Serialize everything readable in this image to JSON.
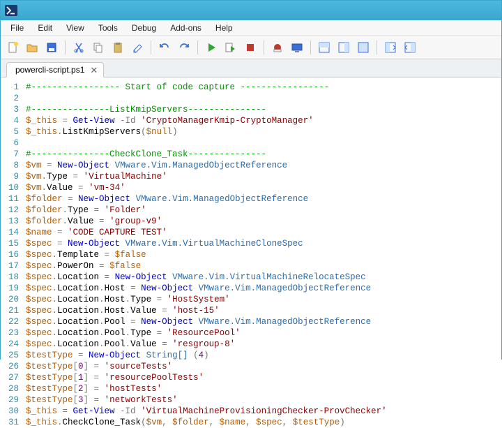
{
  "window": {
    "app_icon": "powershell-icon"
  },
  "menubar": {
    "items": [
      "File",
      "Edit",
      "View",
      "Tools",
      "Debug",
      "Add-ons",
      "Help"
    ]
  },
  "toolbar": {
    "buttons": [
      {
        "name": "new-file-icon"
      },
      {
        "name": "open-file-icon"
      },
      {
        "name": "save-icon"
      },
      {
        "sep": true
      },
      {
        "name": "cut-icon"
      },
      {
        "name": "copy-icon"
      },
      {
        "name": "paste-icon"
      },
      {
        "name": "clear-icon"
      },
      {
        "sep": true
      },
      {
        "name": "undo-icon"
      },
      {
        "name": "redo-icon"
      },
      {
        "sep": true
      },
      {
        "name": "run-icon"
      },
      {
        "name": "run-selection-icon"
      },
      {
        "name": "stop-icon"
      },
      {
        "sep": true
      },
      {
        "name": "breakpoint-icon"
      },
      {
        "name": "remote-icon"
      },
      {
        "sep": true
      },
      {
        "name": "pane-script-icon"
      },
      {
        "name": "pane-right-icon"
      },
      {
        "name": "pane-max-icon"
      },
      {
        "sep": true
      },
      {
        "name": "show-commands-icon"
      },
      {
        "name": "show-addon-icon"
      }
    ]
  },
  "tab": {
    "label": "powercli-script.ps1",
    "close": "✕"
  },
  "code": {
    "lines": [
      [
        {
          "t": "comment",
          "v": "#----------------- Start of code capture -----------------"
        }
      ],
      [],
      [
        {
          "t": "comment",
          "v": "#---------------ListKmipServers---------------"
        }
      ],
      [
        {
          "t": "var",
          "v": "$_this"
        },
        {
          "t": "punc",
          "v": " = "
        },
        {
          "t": "cmdlet",
          "v": "Get-View"
        },
        {
          "t": "punc",
          "v": " -Id "
        },
        {
          "t": "str",
          "v": "'CryptoManagerKmip-CryptoManager'"
        }
      ],
      [
        {
          "t": "var",
          "v": "$_this"
        },
        {
          "t": "punc",
          "v": "."
        },
        {
          "t": "prop",
          "v": "ListKmipServers"
        },
        {
          "t": "punc",
          "v": "("
        },
        {
          "t": "var",
          "v": "$null"
        },
        {
          "t": "punc",
          "v": ")"
        }
      ],
      [],
      [
        {
          "t": "comment",
          "v": "#---------------CheckClone_Task---------------"
        }
      ],
      [
        {
          "t": "var",
          "v": "$vm"
        },
        {
          "t": "punc",
          "v": " = "
        },
        {
          "t": "cmdlet",
          "v": "New-Object"
        },
        {
          "t": "punc",
          "v": " "
        },
        {
          "t": "type",
          "v": "VMware.Vim.ManagedObjectReference"
        }
      ],
      [
        {
          "t": "var",
          "v": "$vm"
        },
        {
          "t": "punc",
          "v": "."
        },
        {
          "t": "prop",
          "v": "Type"
        },
        {
          "t": "punc",
          "v": " = "
        },
        {
          "t": "str",
          "v": "'VirtualMachine'"
        }
      ],
      [
        {
          "t": "var",
          "v": "$vm"
        },
        {
          "t": "punc",
          "v": "."
        },
        {
          "t": "prop",
          "v": "Value"
        },
        {
          "t": "punc",
          "v": " = "
        },
        {
          "t": "str",
          "v": "'vm-34'"
        }
      ],
      [
        {
          "t": "var",
          "v": "$folder"
        },
        {
          "t": "punc",
          "v": " = "
        },
        {
          "t": "cmdlet",
          "v": "New-Object"
        },
        {
          "t": "punc",
          "v": " "
        },
        {
          "t": "type",
          "v": "VMware.Vim.ManagedObjectReference"
        }
      ],
      [
        {
          "t": "var",
          "v": "$folder"
        },
        {
          "t": "punc",
          "v": "."
        },
        {
          "t": "prop",
          "v": "Type"
        },
        {
          "t": "punc",
          "v": " = "
        },
        {
          "t": "str",
          "v": "'Folder'"
        }
      ],
      [
        {
          "t": "var",
          "v": "$folder"
        },
        {
          "t": "punc",
          "v": "."
        },
        {
          "t": "prop",
          "v": "Value"
        },
        {
          "t": "punc",
          "v": " = "
        },
        {
          "t": "str",
          "v": "'group-v9'"
        }
      ],
      [
        {
          "t": "var",
          "v": "$name"
        },
        {
          "t": "punc",
          "v": " = "
        },
        {
          "t": "str",
          "v": "'CODE CAPTURE TEST'"
        }
      ],
      [
        {
          "t": "var",
          "v": "$spec"
        },
        {
          "t": "punc",
          "v": " = "
        },
        {
          "t": "cmdlet",
          "v": "New-Object"
        },
        {
          "t": "punc",
          "v": " "
        },
        {
          "t": "type",
          "v": "VMware.Vim.VirtualMachineCloneSpec"
        }
      ],
      [
        {
          "t": "var",
          "v": "$spec"
        },
        {
          "t": "punc",
          "v": "."
        },
        {
          "t": "prop",
          "v": "Template"
        },
        {
          "t": "punc",
          "v": " = "
        },
        {
          "t": "var",
          "v": "$false"
        }
      ],
      [
        {
          "t": "var",
          "v": "$spec"
        },
        {
          "t": "punc",
          "v": "."
        },
        {
          "t": "prop",
          "v": "PowerOn"
        },
        {
          "t": "punc",
          "v": " = "
        },
        {
          "t": "var",
          "v": "$false"
        }
      ],
      [
        {
          "t": "var",
          "v": "$spec"
        },
        {
          "t": "punc",
          "v": "."
        },
        {
          "t": "prop",
          "v": "Location"
        },
        {
          "t": "punc",
          "v": " = "
        },
        {
          "t": "cmdlet",
          "v": "New-Object"
        },
        {
          "t": "punc",
          "v": " "
        },
        {
          "t": "type",
          "v": "VMware.Vim.VirtualMachineRelocateSpec"
        }
      ],
      [
        {
          "t": "var",
          "v": "$spec"
        },
        {
          "t": "punc",
          "v": "."
        },
        {
          "t": "prop",
          "v": "Location"
        },
        {
          "t": "punc",
          "v": "."
        },
        {
          "t": "prop",
          "v": "Host"
        },
        {
          "t": "punc",
          "v": " = "
        },
        {
          "t": "cmdlet",
          "v": "New-Object"
        },
        {
          "t": "punc",
          "v": " "
        },
        {
          "t": "type",
          "v": "VMware.Vim.ManagedObjectReference"
        }
      ],
      [
        {
          "t": "var",
          "v": "$spec"
        },
        {
          "t": "punc",
          "v": "."
        },
        {
          "t": "prop",
          "v": "Location"
        },
        {
          "t": "punc",
          "v": "."
        },
        {
          "t": "prop",
          "v": "Host"
        },
        {
          "t": "punc",
          "v": "."
        },
        {
          "t": "prop",
          "v": "Type"
        },
        {
          "t": "punc",
          "v": " = "
        },
        {
          "t": "str",
          "v": "'HostSystem'"
        }
      ],
      [
        {
          "t": "var",
          "v": "$spec"
        },
        {
          "t": "punc",
          "v": "."
        },
        {
          "t": "prop",
          "v": "Location"
        },
        {
          "t": "punc",
          "v": "."
        },
        {
          "t": "prop",
          "v": "Host"
        },
        {
          "t": "punc",
          "v": "."
        },
        {
          "t": "prop",
          "v": "Value"
        },
        {
          "t": "punc",
          "v": " = "
        },
        {
          "t": "str",
          "v": "'host-15'"
        }
      ],
      [
        {
          "t": "var",
          "v": "$spec"
        },
        {
          "t": "punc",
          "v": "."
        },
        {
          "t": "prop",
          "v": "Location"
        },
        {
          "t": "punc",
          "v": "."
        },
        {
          "t": "prop",
          "v": "Pool"
        },
        {
          "t": "punc",
          "v": " = "
        },
        {
          "t": "cmdlet",
          "v": "New-Object"
        },
        {
          "t": "punc",
          "v": " "
        },
        {
          "t": "type",
          "v": "VMware.Vim.ManagedObjectReference"
        }
      ],
      [
        {
          "t": "var",
          "v": "$spec"
        },
        {
          "t": "punc",
          "v": "."
        },
        {
          "t": "prop",
          "v": "Location"
        },
        {
          "t": "punc",
          "v": "."
        },
        {
          "t": "prop",
          "v": "Pool"
        },
        {
          "t": "punc",
          "v": "."
        },
        {
          "t": "prop",
          "v": "Type"
        },
        {
          "t": "punc",
          "v": " = "
        },
        {
          "t": "str",
          "v": "'ResourcePool'"
        }
      ],
      [
        {
          "t": "var",
          "v": "$spec"
        },
        {
          "t": "punc",
          "v": "."
        },
        {
          "t": "prop",
          "v": "Location"
        },
        {
          "t": "punc",
          "v": "."
        },
        {
          "t": "prop",
          "v": "Pool"
        },
        {
          "t": "punc",
          "v": "."
        },
        {
          "t": "prop",
          "v": "Value"
        },
        {
          "t": "punc",
          "v": " = "
        },
        {
          "t": "str",
          "v": "'resgroup-8'"
        }
      ],
      [
        {
          "t": "var",
          "v": "$testType"
        },
        {
          "t": "punc",
          "v": " = "
        },
        {
          "t": "cmdlet",
          "v": "New-Object"
        },
        {
          "t": "punc",
          "v": " "
        },
        {
          "t": "type",
          "v": "String[]"
        },
        {
          "t": "punc",
          "v": " ("
        },
        {
          "t": "num",
          "v": "4"
        },
        {
          "t": "punc",
          "v": ")"
        }
      ],
      [
        {
          "t": "var",
          "v": "$testType"
        },
        {
          "t": "punc",
          "v": "["
        },
        {
          "t": "num",
          "v": "0"
        },
        {
          "t": "punc",
          "v": "] = "
        },
        {
          "t": "str",
          "v": "'sourceTests'"
        }
      ],
      [
        {
          "t": "var",
          "v": "$testType"
        },
        {
          "t": "punc",
          "v": "["
        },
        {
          "t": "num",
          "v": "1"
        },
        {
          "t": "punc",
          "v": "] = "
        },
        {
          "t": "str",
          "v": "'resourcePoolTests'"
        }
      ],
      [
        {
          "t": "var",
          "v": "$testType"
        },
        {
          "t": "punc",
          "v": "["
        },
        {
          "t": "num",
          "v": "2"
        },
        {
          "t": "punc",
          "v": "] = "
        },
        {
          "t": "str",
          "v": "'hostTests'"
        }
      ],
      [
        {
          "t": "var",
          "v": "$testType"
        },
        {
          "t": "punc",
          "v": "["
        },
        {
          "t": "num",
          "v": "3"
        },
        {
          "t": "punc",
          "v": "] = "
        },
        {
          "t": "str",
          "v": "'networkTests'"
        }
      ],
      [
        {
          "t": "var",
          "v": "$_this"
        },
        {
          "t": "punc",
          "v": " = "
        },
        {
          "t": "cmdlet",
          "v": "Get-View"
        },
        {
          "t": "punc",
          "v": " -Id "
        },
        {
          "t": "str",
          "v": "'VirtualMachineProvisioningChecker-ProvChecker'"
        }
      ],
      [
        {
          "t": "var",
          "v": "$_this"
        },
        {
          "t": "punc",
          "v": "."
        },
        {
          "t": "prop",
          "v": "CheckClone_Task"
        },
        {
          "t": "punc",
          "v": "("
        },
        {
          "t": "var",
          "v": "$vm"
        },
        {
          "t": "punc",
          "v": ", "
        },
        {
          "t": "var",
          "v": "$folder"
        },
        {
          "t": "punc",
          "v": ", "
        },
        {
          "t": "var",
          "v": "$name"
        },
        {
          "t": "punc",
          "v": ", "
        },
        {
          "t": "var",
          "v": "$spec"
        },
        {
          "t": "punc",
          "v": ", "
        },
        {
          "t": "var",
          "v": "$testType"
        },
        {
          "t": "punc",
          "v": ")"
        }
      ]
    ]
  }
}
